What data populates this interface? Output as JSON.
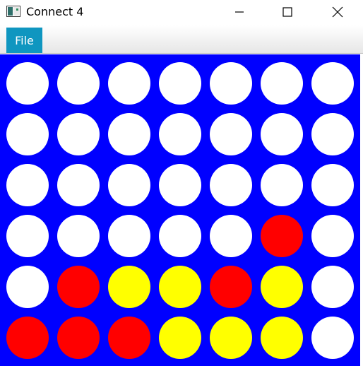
{
  "window": {
    "title": "Connect 4",
    "icon": "app-window-icon"
  },
  "menu": {
    "file_label": "File"
  },
  "colors": {
    "board": "#0000ff",
    "empty": "#ffffff",
    "red": "#ff0000",
    "yellow": "#ffff00",
    "menu_active": "#0f96c0"
  },
  "board": {
    "rows": 6,
    "columns": 7,
    "cells": [
      [
        "empty",
        "empty",
        "empty",
        "empty",
        "empty",
        "empty",
        "empty"
      ],
      [
        "empty",
        "empty",
        "empty",
        "empty",
        "empty",
        "empty",
        "empty"
      ],
      [
        "empty",
        "empty",
        "empty",
        "empty",
        "empty",
        "empty",
        "empty"
      ],
      [
        "empty",
        "empty",
        "empty",
        "empty",
        "empty",
        "red",
        "empty"
      ],
      [
        "empty",
        "red",
        "yellow",
        "yellow",
        "red",
        "yellow",
        "empty"
      ],
      [
        "red",
        "red",
        "red",
        "yellow",
        "yellow",
        "yellow",
        "empty"
      ]
    ]
  }
}
